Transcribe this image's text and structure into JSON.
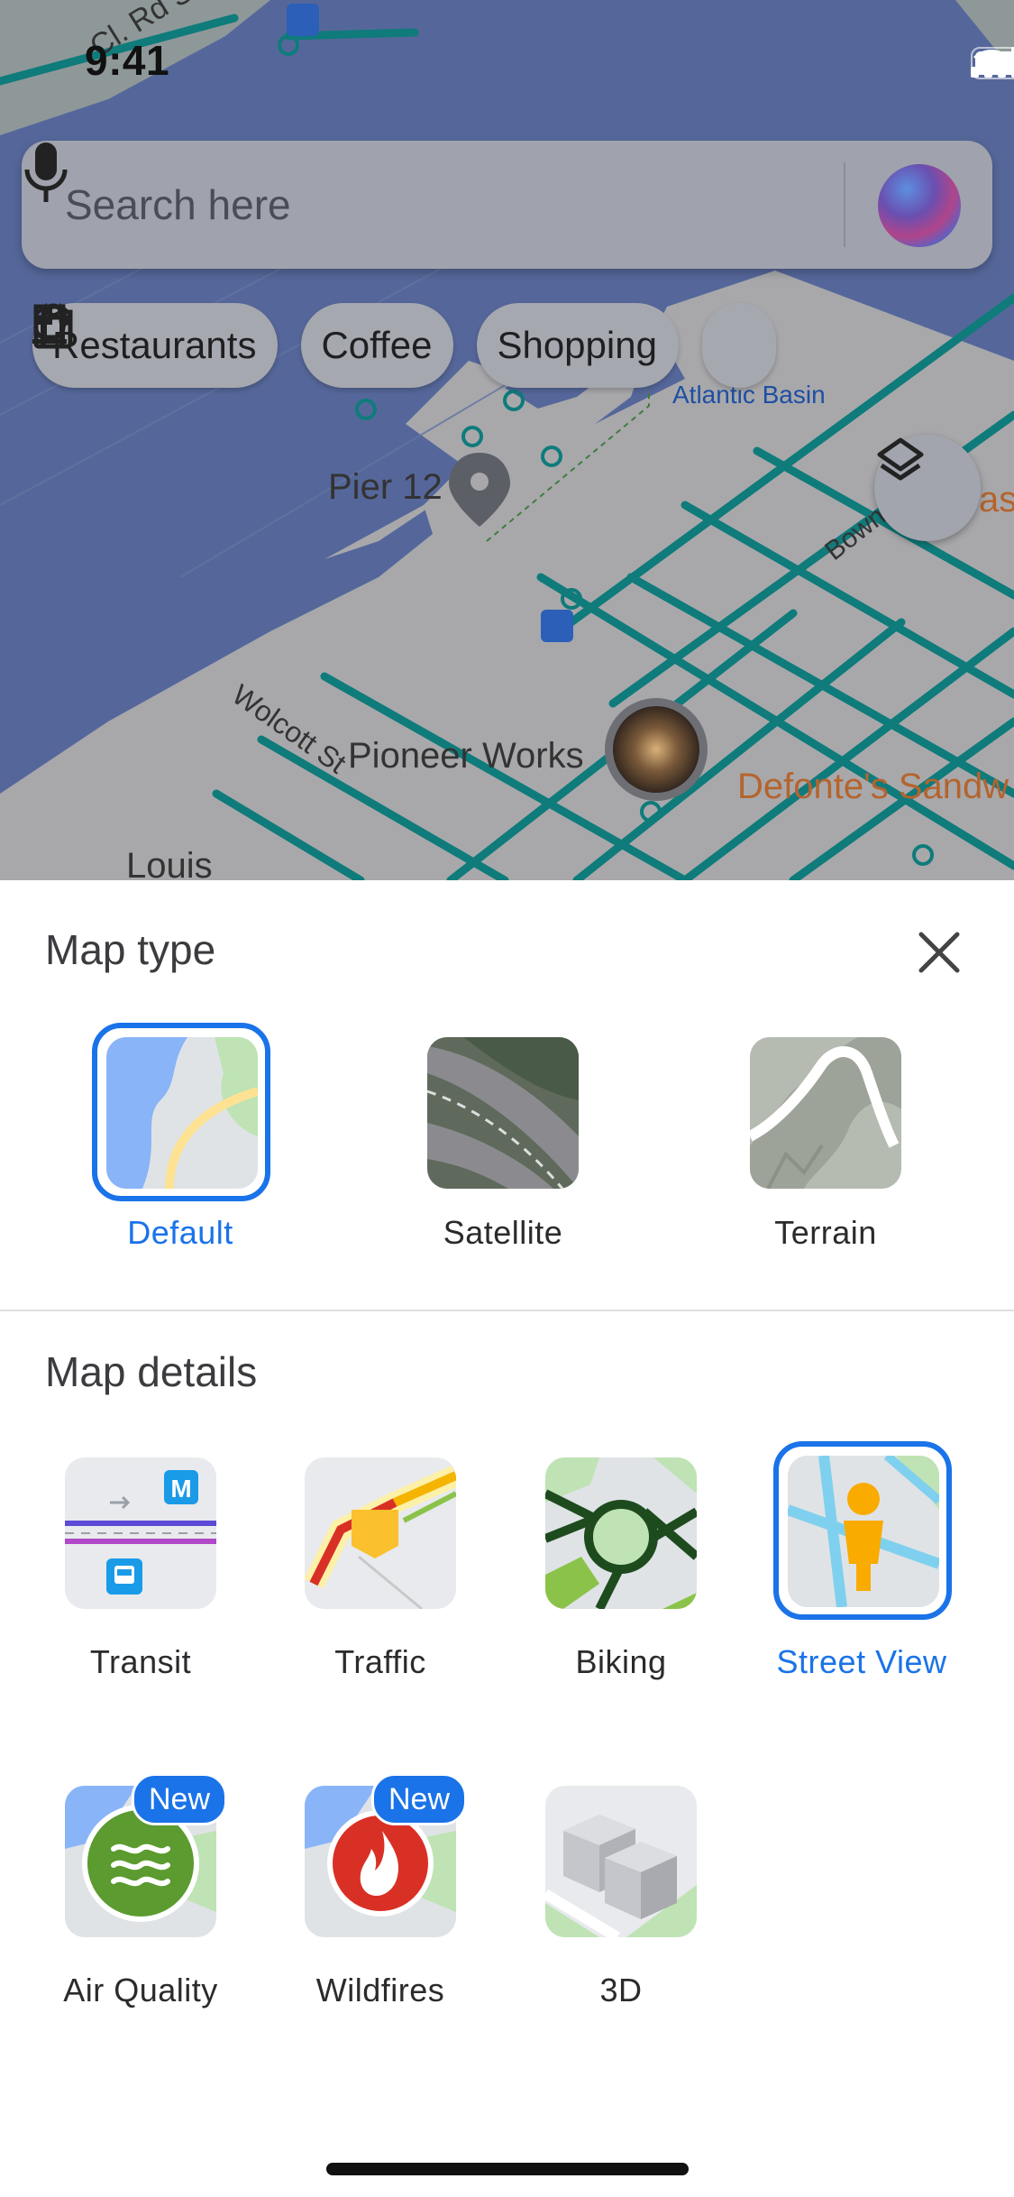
{
  "status_bar": {
    "time": "9:41"
  },
  "search": {
    "placeholder": "Search here"
  },
  "chips": [
    {
      "label": "Restaurants",
      "icon": "fork-knife-icon"
    },
    {
      "label": "Coffee",
      "icon": "coffee-cup-icon"
    },
    {
      "label": "Shopping",
      "icon": "shopping-bag-icon"
    }
  ],
  "map_labels": {
    "street_top": "Cl. Rd S",
    "atlantic": "Atlantic Basin",
    "pier": "Pier 12",
    "bowne": "Bowne",
    "wolcott": "Wolcott St",
    "pioneer": "Pioneer Works",
    "defonte": "Defonte's Sandw",
    "louis": "Louis",
    "partial_right": "as"
  },
  "sheet": {
    "map_type_title": "Map type",
    "map_details_title": "Map details",
    "map_types": [
      {
        "label": "Default",
        "selected": true
      },
      {
        "label": "Satellite",
        "selected": false
      },
      {
        "label": "Terrain",
        "selected": false
      }
    ],
    "map_details": [
      {
        "label": "Transit",
        "selected": false
      },
      {
        "label": "Traffic",
        "selected": false
      },
      {
        "label": "Biking",
        "selected": false
      },
      {
        "label": "Street View",
        "selected": true
      },
      {
        "label": "Air Quality",
        "selected": false,
        "badge": "New"
      },
      {
        "label": "Wildfires",
        "selected": false,
        "badge": "New"
      },
      {
        "label": "3D",
        "selected": false
      }
    ]
  },
  "colors": {
    "accent": "#1a73e8",
    "map_water": "#56689a",
    "map_land": "#a9a9ac",
    "transit_line": "#0d7c7c"
  }
}
